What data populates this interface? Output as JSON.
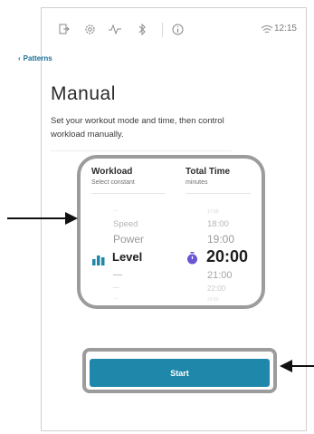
{
  "status_bar": {
    "icons": [
      "exit-icon",
      "gear-icon",
      "heart-rate-icon",
      "bluetooth-icon",
      "info-icon",
      "wifi-icon"
    ],
    "time": "12:15"
  },
  "nav": {
    "back_label": "Patterns"
  },
  "page": {
    "title": "Manual",
    "description": "Set your workout mode and time, then control workload manually."
  },
  "workload": {
    "title": "Workload",
    "subtitle": "Select constant",
    "options_above": [
      "—",
      "Speed",
      "Power"
    ],
    "selected": "Level",
    "options_below": [
      "—",
      "—",
      "—"
    ]
  },
  "total_time": {
    "title": "Total Time",
    "subtitle": "minutes",
    "options_above": [
      "17:00",
      "18:00",
      "19:00"
    ],
    "selected": "20:00",
    "options_below": [
      "21:00",
      "22:00",
      "23:00"
    ]
  },
  "actions": {
    "start_label": "Start"
  },
  "colors": {
    "accent": "#1f87a9",
    "link": "#1c6f96",
    "timer_icon": "#6a55d6",
    "frame": "#9c9c9c"
  }
}
